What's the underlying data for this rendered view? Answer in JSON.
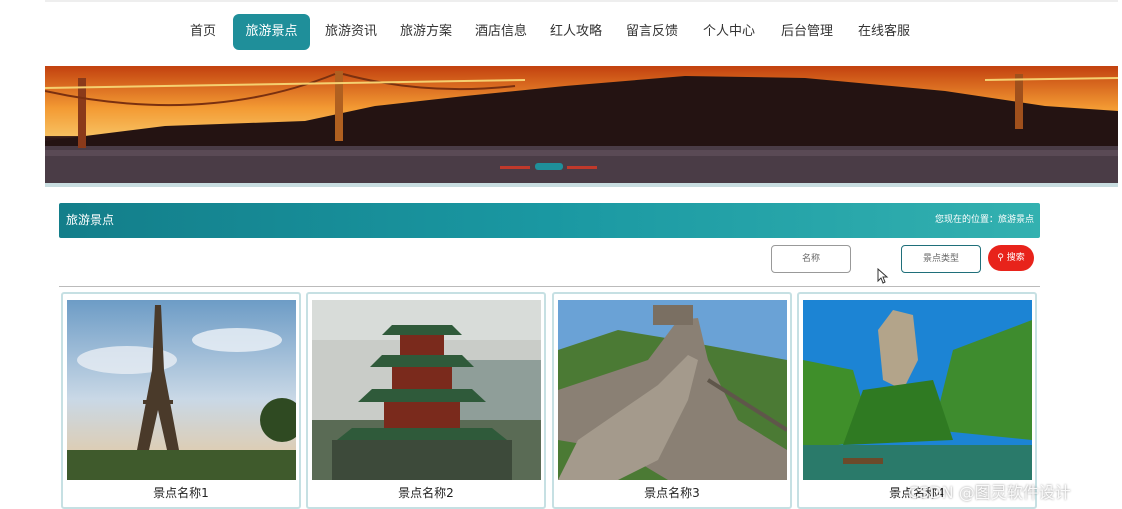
{
  "nav": {
    "items": [
      {
        "label": "首页",
        "active": false
      },
      {
        "label": "旅游景点",
        "active": true
      },
      {
        "label": "旅游资讯",
        "active": false
      },
      {
        "label": "旅游方案",
        "active": false
      },
      {
        "label": "酒店信息",
        "active": false
      },
      {
        "label": "红人攻略",
        "active": false
      },
      {
        "label": "留言反馈",
        "active": false
      },
      {
        "label": "个人中心",
        "active": false
      },
      {
        "label": "后台管理",
        "active": false
      },
      {
        "label": "在线客服",
        "active": false
      }
    ]
  },
  "section": {
    "title": "旅游景点",
    "breadcrumb": "您现在的位置：旅游景点"
  },
  "search": {
    "name_placeholder": "名称",
    "type_placeholder": "景点类型",
    "button_label": "搜索"
  },
  "cards": [
    {
      "name": "景点名称1"
    },
    {
      "name": "景点名称2"
    },
    {
      "name": "景点名称3"
    },
    {
      "name": "景点名称4"
    }
  ],
  "watermark": "CSDN @图灵软件设计",
  "colors": {
    "accent": "#1f8f9a",
    "search_button": "#e8231b"
  }
}
